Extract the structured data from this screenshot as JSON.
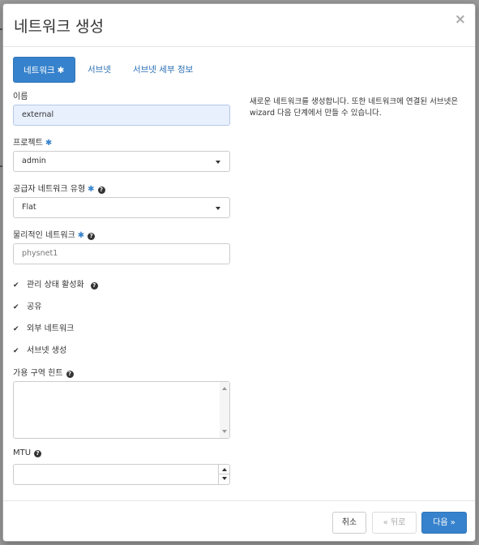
{
  "modal": {
    "title": "네트워크 생성",
    "close_label": "×"
  },
  "tabs": [
    {
      "label": "네트워크",
      "required_mark": "✱",
      "active": true
    },
    {
      "label": "서브넷",
      "active": false
    },
    {
      "label": "서브넷 세부 정보",
      "active": false
    }
  ],
  "form": {
    "name": {
      "label": "이름",
      "value": "external"
    },
    "project": {
      "label": "프로젝트",
      "required_mark": "✱",
      "selected": "admin"
    },
    "provider_network_type": {
      "label": "공급자 네트워크 유형",
      "required_mark": "✱",
      "help": "?",
      "selected": "Flat"
    },
    "physical_network": {
      "label": "물리적인 네트워크",
      "required_mark": "✱",
      "help": "?",
      "value": "physnet1"
    },
    "checkboxes": [
      {
        "label": "관리 상태 활성화",
        "checked": true,
        "help": "?"
      },
      {
        "label": "공유",
        "checked": true
      },
      {
        "label": "외부 네트워크",
        "checked": true
      },
      {
        "label": "서브넷 생성",
        "checked": true
      }
    ],
    "availability_zone_hints": {
      "label": "가용 구역 힌트",
      "help": "?"
    },
    "mtu": {
      "label": "MTU",
      "help": "?",
      "value": ""
    }
  },
  "description": "새로운 네트워크를 생성합니다. 또한 네트워크에 연결된 서브넷은 wizard 다음 단계에서 만들 수 있습니다.",
  "footer": {
    "cancel_label": "취소",
    "back_label": "« 뒤로",
    "next_label": "다음 »"
  },
  "icons": {
    "check": "✔",
    "close": "close-icon",
    "help": "help-icon"
  },
  "colors": {
    "primary": "#3782cc",
    "required": "#3782cc",
    "autofill_bg": "#e8f0fe"
  }
}
